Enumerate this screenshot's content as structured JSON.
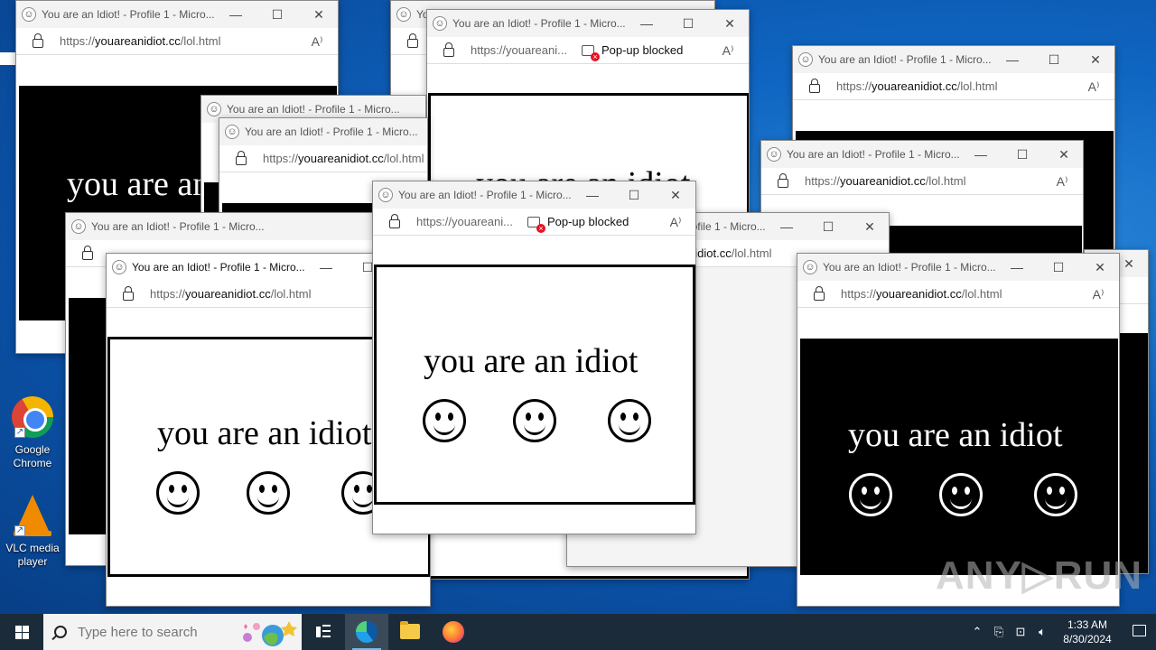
{
  "desktop": {
    "icons": [
      {
        "label": "Google Chrome",
        "icon": "chrome-icon"
      },
      {
        "label": "VLC media player",
        "icon": "vlc-icon"
      }
    ]
  },
  "browser": {
    "title": "You are an Idiot! - Profile 1 - Micro...",
    "url_prefix": "https://",
    "url_host": "youareanidiot.cc",
    "url_path": "/lol.html",
    "url_truncated": "https://youareani...",
    "popup_blocked": "Pop-up blocked",
    "controls": {
      "minimize": "—",
      "maximize": "☐",
      "close": "✕"
    },
    "read_aloud": "A⁾"
  },
  "page": {
    "message": "you are an idiot",
    "smiley": "smiley-face-icon",
    "colors": {
      "white_phase_bg": "#ffffff",
      "black_phase_bg": "#000000"
    }
  },
  "taskbar": {
    "search_placeholder": "Type here to search",
    "pinned": [
      "task-view-icon",
      "edge-icon",
      "file-explorer-icon",
      "firefox-icon"
    ],
    "clock": {
      "time": "1:33 AM",
      "date": "8/30/2024"
    }
  },
  "watermark": "ANY▷RUN"
}
